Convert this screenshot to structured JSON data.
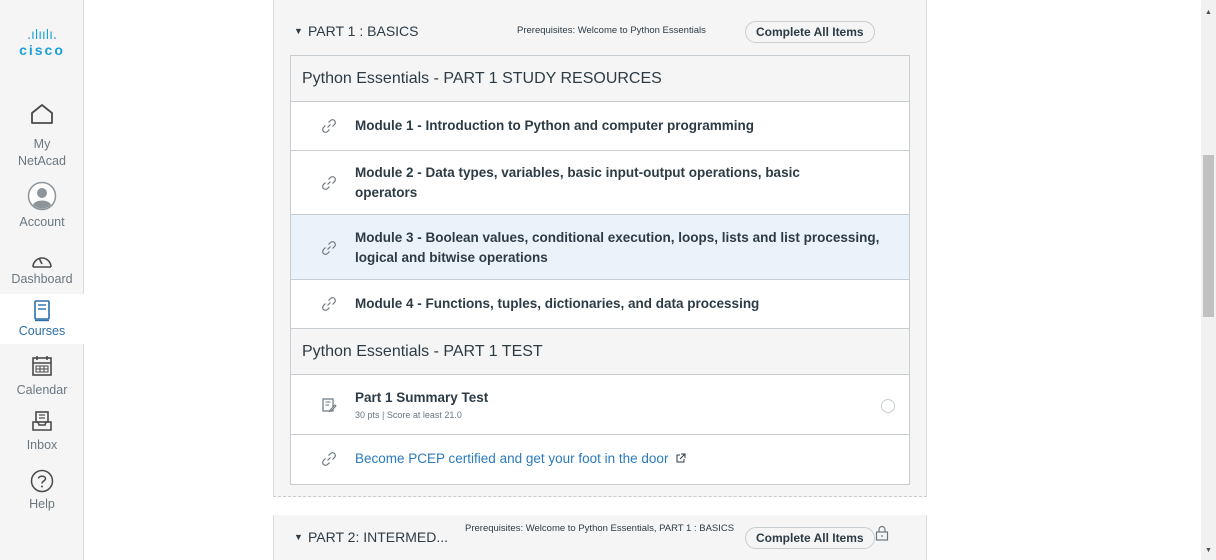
{
  "brand": {
    "logo_bars": ".ılıılı.",
    "logo_text": "cisco"
  },
  "nav": [
    {
      "label_line1": "My",
      "label_line2": "NetAcad",
      "icon": "home-icon"
    },
    {
      "label": "Account",
      "icon": "avatar-icon"
    },
    {
      "label": "Dashboard",
      "icon": "dashboard-icon"
    },
    {
      "label": "Courses",
      "icon": "book-icon",
      "active": true
    },
    {
      "label": "Calendar",
      "icon": "calendar-icon"
    },
    {
      "label": "Inbox",
      "icon": "inbox-icon"
    },
    {
      "label": "Help",
      "icon": "help-icon"
    }
  ],
  "module1": {
    "title": "PART 1 : BASICS",
    "prerequisites": "Prerequisites: Welcome to Python Essentials",
    "complete_all": "Complete All Items",
    "sub_header_resources": "Python Essentials - PART 1 STUDY RESOURCES",
    "items": [
      {
        "title": "Module 1 - Introduction to Python and computer programming",
        "icon": "link-icon"
      },
      {
        "title_line1": "Module 2 - Data types, variables, basic input-output operations, basic",
        "title_line2": "operators",
        "icon": "link-icon"
      },
      {
        "title_line1": "Module 3 - Boolean values, conditional execution, loops, lists and list processing,",
        "title_line2": "logical and bitwise operations",
        "icon": "link-icon"
      },
      {
        "title": "Module 4 - Functions, tuples, dictionaries, and data processing",
        "icon": "link-icon"
      }
    ],
    "sub_header_test": "Python Essentials - PART 1 TEST",
    "test": {
      "title": "Part 1 Summary Test",
      "meta": "30 pts  |  Score at least 21.0",
      "icon": "quiz-icon"
    },
    "external": {
      "title": "Become PCEP certified and get your foot in the door",
      "icon": "link-icon",
      "suffix_icon": "external-link-icon"
    }
  },
  "module2": {
    "title": "PART 2: INTERMED...",
    "prerequisites": "Prerequisites: Welcome to Python Essentials, PART 1 : BASICS",
    "complete_all": "Complete All Items",
    "lock_icon": "lock-icon"
  },
  "colors": {
    "accent": "#2b7abc",
    "logo": "#1ba0d7",
    "highlight": "#eaf2fa"
  }
}
